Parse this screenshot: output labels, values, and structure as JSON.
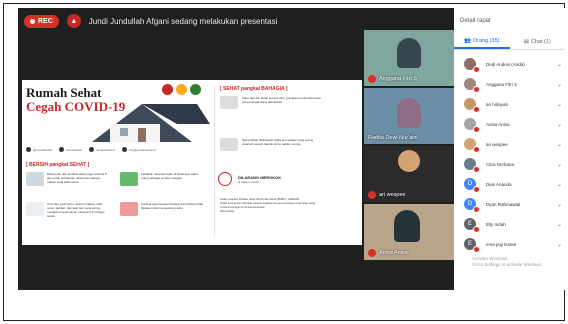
{
  "topbar": {
    "rec_label": "REC",
    "presenting_text": "Jundi Jundullah Afgani sedang melakukan presentasi"
  },
  "slide": {
    "title_line1": "Rumah Sehat",
    "title_line2": "Cegah COVID-19",
    "sections": {
      "sehat_prefix": "[ BERSIH pangkal SEHAT ]",
      "bahagia_prefix": "[ SEHAT pangkal BAHAGIA ]"
    },
    "tiles_left": [
      "Buka pintu dan jendela setiap pagi minimal 8 jam untuk pertukaran udara dan cahaya masuk yang lebih sehat",
      "Letakkan tanaman hijau di beberapa sudut ruang sebagai sumber oksigen",
      "Cuci dan ganti sprei, selimut, karpet, sofa cover, gorden, dan kain lain yang sering menjadi tempat kuman minimal 1-2 minggu sekali",
      "Kurangi penumpukan barang dan barang tidak dipakai untuk mengurangi debu"
    ],
    "tiles_right": [
      "Sapu dan Pel lantai secara rutin, gunakan pembersih lantai yang mengandung disinfektan",
      "Semprotkan disinfektan pada permukaan yang sering disentuh seperti handle pintu, saklar, remote"
    ],
    "smoke_title": "DILARANG MEROKOK",
    "smoke_sub": "di dalam rumah",
    "bullets": [
      "Selalu terapkan Perilaku Hidup Bersih dan Sehat (PHBS) - GERMAS",
      "Selalu tenang dan waspada, lakukan kegiatan bersama keluarga untuk tetap sehat",
      "Tunda kunjungan ke tempat keramaian",
      "#dirumahaja"
    ],
    "socials": [
      "@rumahsehat",
      "rumahsehat",
      "rumahsehat.id",
      "info@rumahsehat.id"
    ]
  },
  "video_tiles": [
    {
      "name": "Anggana Fitri S",
      "bg": "#7fa7a0"
    },
    {
      "name": "Radita Dewi Nur'aini",
      "bg": "#6c8fa8"
    },
    {
      "name": "ari wespee",
      "bg": "#2b2b2b"
    },
    {
      "name": "Anisa Anisa",
      "bg": "#b9a58a"
    }
  ],
  "panel": {
    "header": "Detail rapat",
    "tab_people": "Orang (35)",
    "tab_chat": "Chat (1)",
    "participants": [
      {
        "name": "Dedi Andesi (Anda)",
        "color": "#8d6e63",
        "initial": ""
      },
      {
        "name": "Anggana Fitri S",
        "color": "#a1887f",
        "initial": ""
      },
      {
        "name": "ari hidayati",
        "color": "#c49a6c",
        "initial": ""
      },
      {
        "name": "Anisa Anisa",
        "color": "#a5a5a5",
        "initial": ""
      },
      {
        "name": "ari wespee",
        "color": "#d4a373",
        "initial": ""
      },
      {
        "name": "Citra Nurhana",
        "color": "#6b7b8c",
        "initial": ""
      },
      {
        "name": "Dias Ananda",
        "color": "#4285f4",
        "initial": "D"
      },
      {
        "name": "Dyan Rahmawati",
        "color": "#4285f4",
        "initial": "D"
      },
      {
        "name": "Elly Indah",
        "color": "#5f6368",
        "initial": "E"
      },
      {
        "name": "ema puji lestari",
        "color": "#5f6368",
        "initial": "E"
      }
    ],
    "watermark_line1": "Activate Windows",
    "watermark_line2": "Go to Settings to activate Windows."
  },
  "colors": {
    "accent_blue": "#1a73e8",
    "rec_red": "#d93025",
    "meeting_bg": "#1f1f1f"
  }
}
